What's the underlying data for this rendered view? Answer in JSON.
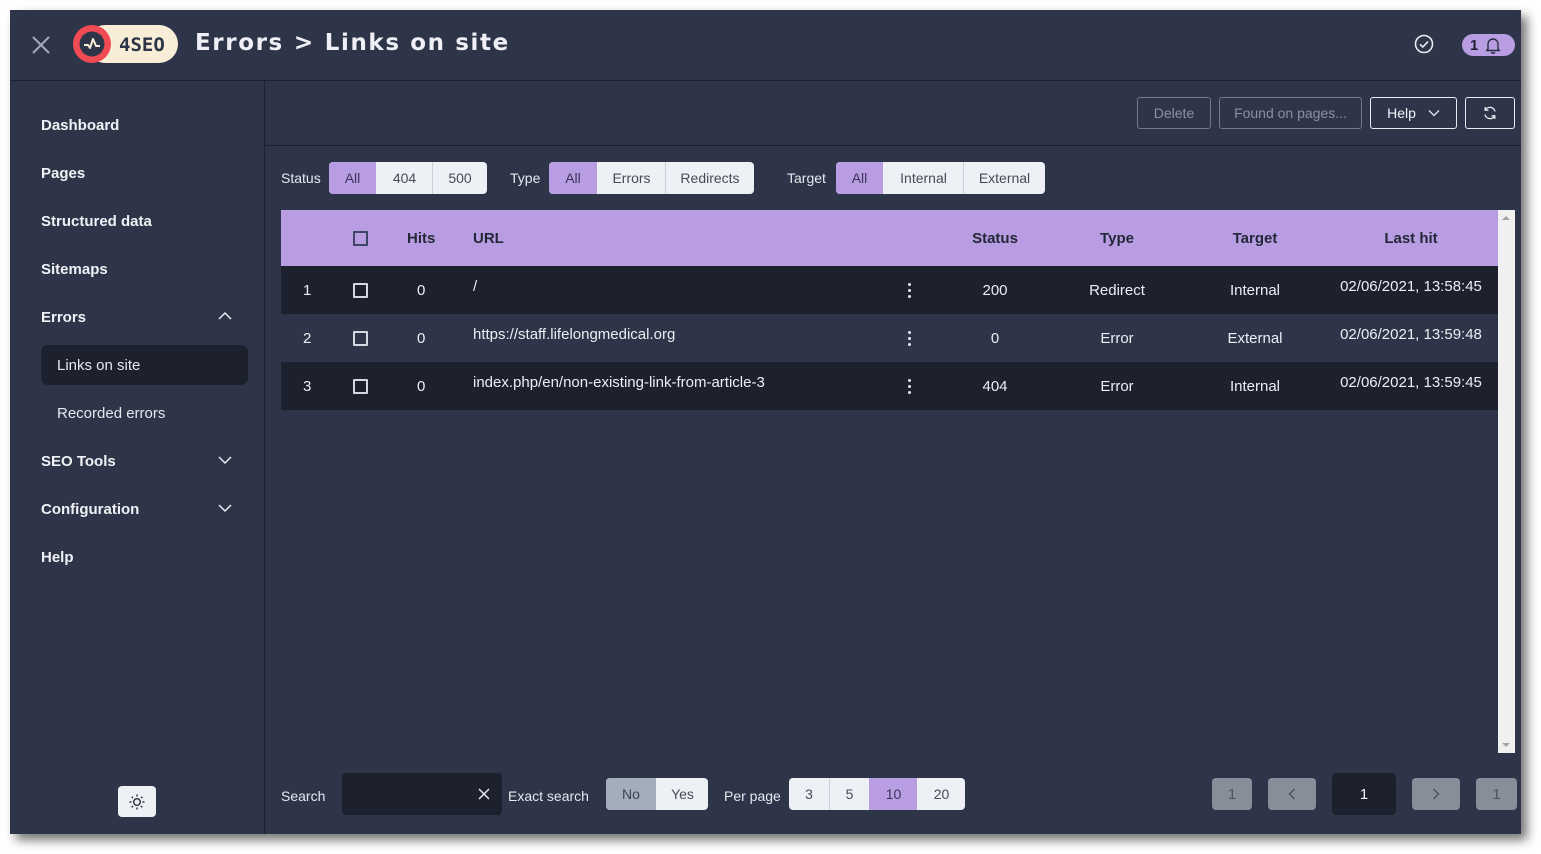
{
  "header": {
    "logo_text": "4SEO",
    "breadcrumb": [
      "Errors",
      "Links on site"
    ],
    "breadcrumb_separator": ">",
    "notification_count": "1"
  },
  "colors": {
    "accent": "#b89de3",
    "background": "#2e3548",
    "dark": "#1c212d",
    "logo_red": "#f04a55",
    "logo_cream": "#f8edd6"
  },
  "sidebar": {
    "items": [
      {
        "label": "Dashboard"
      },
      {
        "label": "Pages"
      },
      {
        "label": "Structured data"
      },
      {
        "label": "Sitemaps"
      },
      {
        "label": "Errors",
        "expanded": true,
        "children": [
          {
            "label": "Links on site",
            "active": true
          },
          {
            "label": "Recorded errors"
          }
        ]
      },
      {
        "label": "SEO Tools",
        "expanded": false
      },
      {
        "label": "Configuration",
        "expanded": false
      },
      {
        "label": "Help"
      }
    ],
    "theme_toggle_icon": "sun-icon"
  },
  "toolbar": {
    "delete_label": "Delete",
    "found_on_pages_label": "Found on pages...",
    "help_label": "Help",
    "refresh_icon": "refresh-icon"
  },
  "filters": {
    "status": {
      "label": "Status",
      "options": [
        "All",
        "404",
        "500"
      ],
      "selected": "All"
    },
    "type": {
      "label": "Type",
      "options": [
        "All",
        "Errors",
        "Redirects"
      ],
      "selected": "All"
    },
    "target": {
      "label": "Target",
      "options": [
        "All",
        "Internal",
        "External"
      ],
      "selected": "All"
    }
  },
  "table": {
    "columns": [
      "",
      "",
      "Hits",
      "URL",
      "",
      "Status",
      "Type",
      "Target",
      "Last hit"
    ],
    "rows": [
      {
        "index": "1",
        "hits": "0",
        "url": "/",
        "status": "200",
        "type": "Redirect",
        "target": "Internal",
        "last_hit": "02/06/2021, 13:58:45"
      },
      {
        "index": "2",
        "hits": "0",
        "url": "https://staff.lifelongmedical.org",
        "status": "0",
        "type": "Error",
        "target": "External",
        "last_hit": "02/06/2021, 13:59:48"
      },
      {
        "index": "3",
        "hits": "0",
        "url": "index.php/en/non-existing-link-from-article-3",
        "status": "404",
        "type": "Error",
        "target": "Internal",
        "last_hit": "02/06/2021, 13:59:45"
      }
    ]
  },
  "footer": {
    "search_label": "Search",
    "search_value": "",
    "exact_search": {
      "label": "Exact search",
      "options": [
        "No",
        "Yes"
      ],
      "selected": "No"
    },
    "per_page": {
      "label": "Per page",
      "options": [
        "3",
        "5",
        "10",
        "20"
      ],
      "selected": "10"
    },
    "pagination": {
      "first": "1",
      "prev": "‹",
      "current": "1",
      "next": "›",
      "last": "1"
    }
  }
}
